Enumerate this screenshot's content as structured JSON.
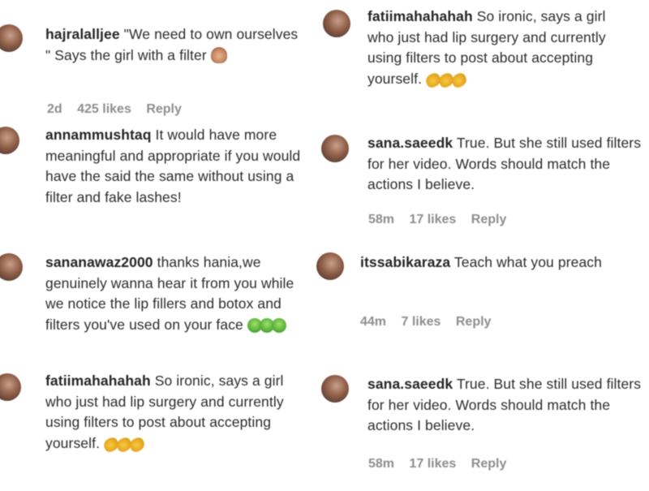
{
  "comments": [
    {
      "username": "hajralalljee",
      "text": "\"We need to own ourselves \" Says the girl with a filter",
      "emoji": "person-facepalming-emoji",
      "time": "2d",
      "likes": "425 likes",
      "reply": "Reply"
    },
    {
      "username": "annammushtaq",
      "text": "It would have more meaningful and appropriate if you would have the said the same without using a filter and fake lashes!",
      "time": "",
      "likes": "",
      "reply": ""
    },
    {
      "username": "sananawaz2000",
      "text": "thanks hania,we genuinely wanna hear it from you while we notice the lip fillers and botox and filters you've used on your face",
      "emoji": "nauseated-face-emoji",
      "time": "",
      "likes": "",
      "reply": ""
    },
    {
      "username": "fatiimahahahah",
      "text": "So ironic, says a girl who just had lip surgery and currently using filters to post about accepting yourself.",
      "emoji": "clapping-hands-emoji",
      "time": "",
      "likes": "",
      "reply": ""
    },
    {
      "username": "fatiimahahahah",
      "text": "So ironic, says a girl who just had lip surgery and currently using filters to post about accepting yourself.",
      "emoji": "clapping-hands-emoji",
      "time": "",
      "likes": "",
      "reply": ""
    },
    {
      "username": "sana.saeedk",
      "text": "True. But she still used filters for her video. Words should match the actions I believe.",
      "time": "58m",
      "likes": "17 likes",
      "reply": "Reply"
    },
    {
      "username": "itssabikaraza",
      "text": "Teach what you preach",
      "time": "44m",
      "likes": "7 likes",
      "reply": "Reply"
    },
    {
      "username": "sana.saeedk",
      "text": "True. But she still used filters for her video. Words should match the actions I believe.",
      "time": "58m",
      "likes": "17 likes",
      "reply": "Reply"
    }
  ]
}
